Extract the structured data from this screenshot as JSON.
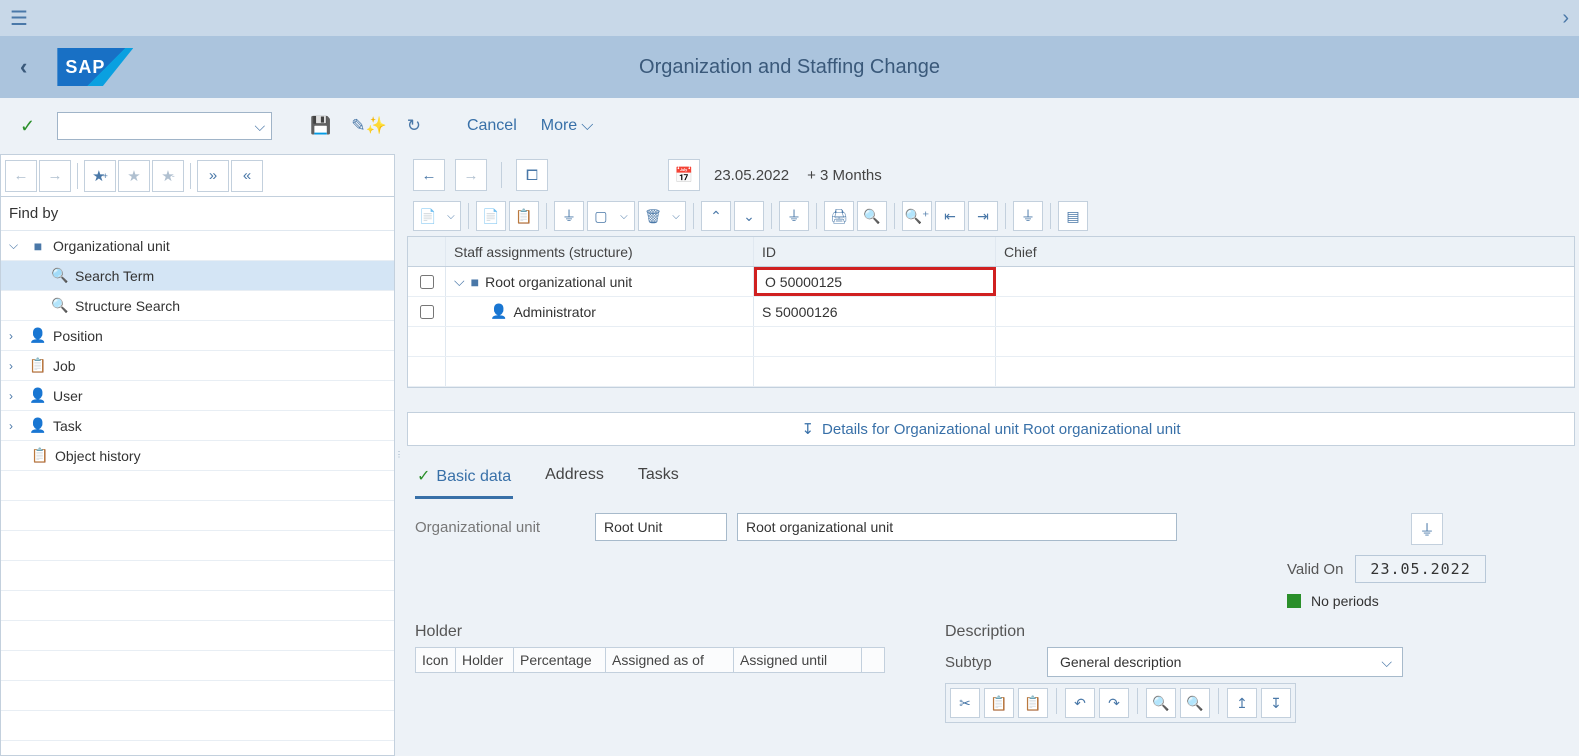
{
  "header": {
    "page_title": "Organization and Staffing Change"
  },
  "toolbar": {
    "cancel": "Cancel",
    "more": "More"
  },
  "sidebar": {
    "findby": "Find by",
    "items": [
      {
        "label": "Organizational unit"
      },
      {
        "label": "Search Term"
      },
      {
        "label": "Structure Search"
      },
      {
        "label": "Position"
      },
      {
        "label": "Job"
      },
      {
        "label": "User"
      },
      {
        "label": "Task"
      },
      {
        "label": "Object history"
      }
    ]
  },
  "content": {
    "date": "23.05.2022",
    "date_range": "+ 3 Months",
    "table": {
      "headers": {
        "staff": "Staff assignments (structure)",
        "id": "ID",
        "chief": "Chief"
      },
      "rows": [
        {
          "label": "Root organizational unit",
          "id": "O  50000125"
        },
        {
          "label": "Administrator",
          "id": "S  50000126"
        }
      ]
    },
    "details_label": "Details for Organizational unit Root organizational unit",
    "tabs": {
      "basic": "Basic data",
      "address": "Address",
      "tasks": "Tasks"
    },
    "form": {
      "org_label": "Organizational unit",
      "org_short": "Root Unit",
      "org_long": "Root organizational unit",
      "valid_label": "Valid On",
      "valid_date": "23.05.2022",
      "noperiods": "No periods"
    },
    "holder": {
      "title": "Holder",
      "cols": {
        "icon": "Icon",
        "holder": "Holder",
        "pct": "Percentage",
        "asof": "Assigned as of",
        "until": "Assigned until"
      }
    },
    "desc": {
      "title": "Description",
      "subtyp_label": "Subtyp",
      "subtyp_value": "General description"
    }
  }
}
